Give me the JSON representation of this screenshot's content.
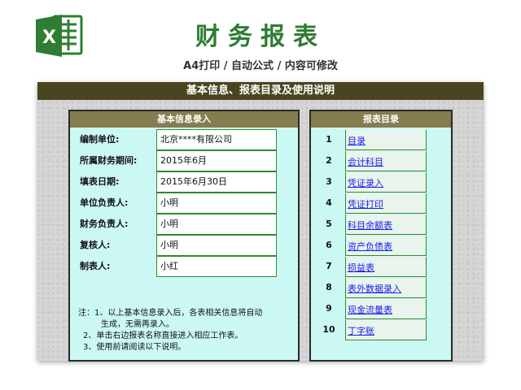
{
  "header": {
    "title": "财务报表",
    "subtitle": "A4打印 / 自动公式 / 内容可修改",
    "logo_letter": "X"
  },
  "sheet": {
    "title": "基本信息、报表目录及使用说明"
  },
  "info": {
    "header": "基本信息录入",
    "rows": [
      {
        "label": "编制单位:",
        "value": "北京****有限公司"
      },
      {
        "label": "所属财务期间:",
        "value": "2015年6月"
      },
      {
        "label": "填表日期:",
        "value": "2015年6月30日"
      },
      {
        "label": "单位负责人:",
        "value": "小明"
      },
      {
        "label": "财务负责人:",
        "value": "小明"
      },
      {
        "label": "复核人:",
        "value": "小明"
      },
      {
        "label": "制表人:",
        "value": "小红"
      }
    ],
    "notes": [
      "注：1、以上基本信息录入后，各表相关信息将自动",
      "       生成，无需再录入。",
      "    2、单击右边报表名称直接进入相应工作表。",
      "    3、使用前请阅读以下说明。"
    ]
  },
  "directory": {
    "header": "报表目录",
    "items": [
      {
        "num": "1",
        "label": "目录"
      },
      {
        "num": "2",
        "label": "会计科目"
      },
      {
        "num": "3",
        "label": "凭证录入"
      },
      {
        "num": "4",
        "label": "凭证打印"
      },
      {
        "num": "5",
        "label": "科目余额表"
      },
      {
        "num": "6",
        "label": "资产负债表"
      },
      {
        "num": "7",
        "label": "损益表"
      },
      {
        "num": "8",
        "label": "表外数据录入"
      },
      {
        "num": "9",
        "label": "现金流量表"
      },
      {
        "num": "10",
        "label": "丁字账"
      }
    ]
  },
  "colors": {
    "title_green": "#2e7d32",
    "sheet_bar": "#4a4520",
    "panel_head": "#857d4f",
    "panel_bg": "#ccf8f4",
    "link_blue": "#1a1aee"
  }
}
